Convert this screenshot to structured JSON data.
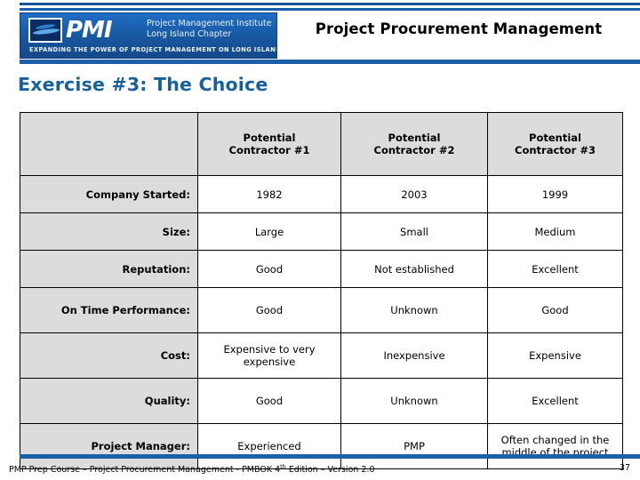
{
  "header": {
    "logo": {
      "brand_mark": "PMI",
      "line1": "Project Management Institute",
      "line2": "Long Island Chapter",
      "tagline": "EXPANDING THE POWER OF PROJECT MANAGEMENT ON LONG ISLAND",
      "island_icon": "long-island-map-icon"
    },
    "title": "Project Procurement Management",
    "accent_color": "#1c5fa9"
  },
  "slide": {
    "heading": "Exercise #3:  The Choice",
    "heading_color": "#17609e"
  },
  "table": {
    "corner_label": "",
    "columns": [
      "Potential Contractor #1",
      "Potential Contractor #2",
      "Potential Contractor #3"
    ],
    "column_lines": [
      [
        "Potential",
        "Contractor #1"
      ],
      [
        "Potential",
        "Contractor #2"
      ],
      [
        "Potential",
        "Contractor #3"
      ]
    ],
    "header_bg": "#dcdcdc",
    "cell_bg": "#ffffff",
    "rows": [
      {
        "label": "Company Started:",
        "values": [
          "1982",
          "2003",
          "1999"
        ]
      },
      {
        "label": "Size:",
        "values": [
          "Large",
          "Small",
          "Medium"
        ]
      },
      {
        "label": "Reputation:",
        "values": [
          "Good",
          "Not established",
          "Excellent"
        ]
      },
      {
        "label": "On Time Performance:",
        "values": [
          "Good",
          "Unknown",
          "Good"
        ]
      },
      {
        "label": "Cost:",
        "values": [
          "Expensive to very expensive",
          "Inexpensive",
          "Expensive"
        ]
      },
      {
        "label": "Quality:",
        "values": [
          "Good",
          "Unknown",
          "Excellent"
        ]
      },
      {
        "label": "Project Manager:",
        "values": [
          "Experienced",
          "PMP",
          "Often changed in the middle of the project"
        ]
      }
    ]
  },
  "footer": {
    "text_before": "PMP Prep Course – Project Procurement Management - PMBOK 4",
    "superscript": "th",
    "text_after": " Edition – Version 2.0",
    "page_number": "37"
  }
}
